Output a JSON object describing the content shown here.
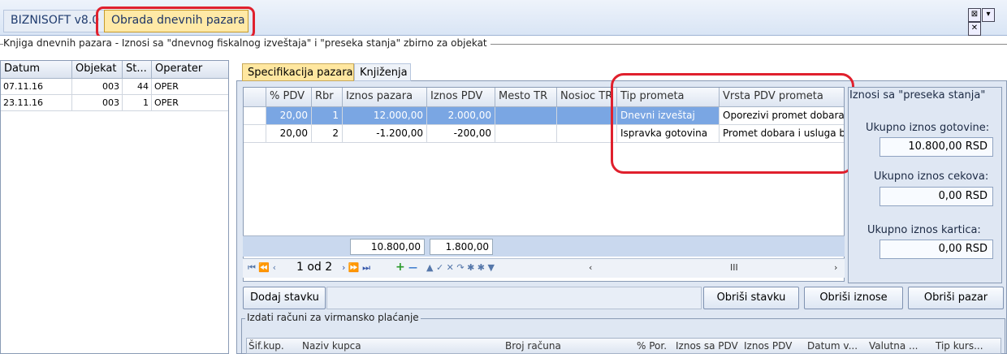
{
  "tabs": {
    "app": "BIZNISOFT v8.0",
    "active": "Obrada dnevnih pazara"
  },
  "window_buttons": [
    "⊠",
    "▾",
    "✕"
  ],
  "caption": "Knjiga dnevnih pazara - Iznosi sa \"dnevnog fiskalnog izveštaja\" i \"preseka stanja\" zbirno za objekat",
  "left_list": {
    "columns": [
      "Datum",
      "Objekat",
      "St...",
      "Operater"
    ],
    "rows": [
      [
        "07.11.16",
        "003",
        "44",
        "OPER"
      ],
      [
        "23.11.16",
        "003",
        "1",
        "OPER"
      ]
    ]
  },
  "subtabs": [
    "Specifikacija pazara",
    "Knjiženja"
  ],
  "grid": {
    "columns": [
      "% PDV",
      "Rbr",
      "Iznos pazara",
      "Iznos PDV",
      "Mesto TR",
      "Nosioc TR",
      "Tip prometa",
      "Vrsta PDV prometa"
    ],
    "rows": [
      [
        "20,00",
        "1",
        "12.000,00",
        "2.000,00",
        "",
        "",
        "Dnevni izveštaj",
        "Oporezivi promet dobara"
      ],
      [
        "20,00",
        "2",
        "-1.200,00",
        "-200,00",
        "",
        "",
        "Ispravka gotovina",
        "Promet dobara i usluga be"
      ]
    ],
    "totals": {
      "iznos_pazara": "10.800,00",
      "iznos_pdv": "1.800,00"
    },
    "nav": {
      "record": "1 od 2",
      "scroll_mid": "III"
    }
  },
  "summary": {
    "title": "Iznosi sa \"preseka stanja\"",
    "gotovina_label": "Ukupno iznos gotovine:",
    "gotovina_value": "10.800,00 RSD",
    "cekova_label": "Ukupno iznos cekova:",
    "cekova_value": "0,00 RSD",
    "kartica_label": "Ukupno iznos kartica:",
    "kartica_value": "0,00 RSD"
  },
  "buttons": {
    "dodaj": "Dodaj stavku",
    "obrisi_stavku": "Obriši stavku",
    "obrisi_iznose": "Obriši iznose",
    "obrisi_pazar": "Obriši pazar"
  },
  "lower": {
    "caption": "Izdati računi za virmansko plaćanje",
    "columns": [
      "Šif.kup.",
      "Naziv kupca",
      "Broj računa",
      "% Por.",
      "Iznos sa PDV",
      "Iznos PDV",
      "Datum v...",
      "Valutna ...",
      "Tip kurs..."
    ]
  },
  "colors": {
    "highlight": "#e0202d",
    "selection": "#7aa6e3",
    "active_tab": "#ffe9a6"
  }
}
